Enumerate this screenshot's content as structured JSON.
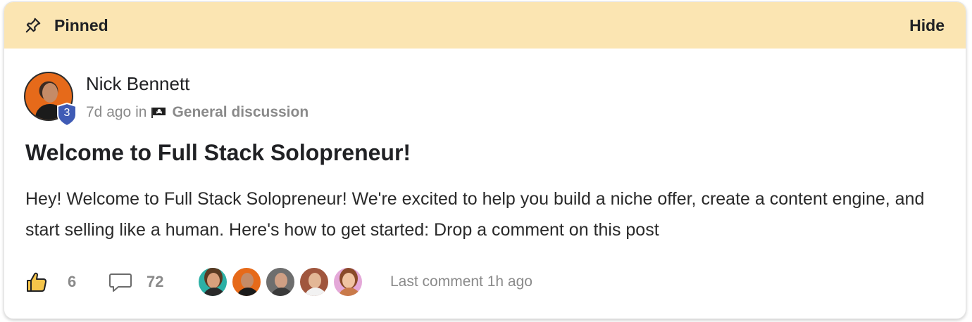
{
  "pinned_bar": {
    "label": "Pinned",
    "hide_label": "Hide",
    "icon": "pushpin-icon"
  },
  "post": {
    "author": {
      "name": "Nick Bennett",
      "level": "3"
    },
    "time_ago": "7d ago",
    "in_label": "in",
    "category": "General discussion",
    "category_icon": "pirate-flag-icon",
    "title": "Welcome to Full Stack Solopreneur!",
    "body": "Hey! Welcome to Full Stack Solopreneur! We're excited to help you build a niche offer, create a content engine, and start selling like a human. Here's how to get started: Drop a comment on this post"
  },
  "footer": {
    "like_count": "6",
    "comment_count": "72",
    "commenter_avatar_count": 5,
    "last_comment": "Last comment 1h ago"
  },
  "colors": {
    "pinned_bg": "#fbe5b2",
    "level_badge": "#3f5bb5",
    "like_icon_fill": "#f5c54a",
    "muted_text": "#8a8a8a"
  }
}
